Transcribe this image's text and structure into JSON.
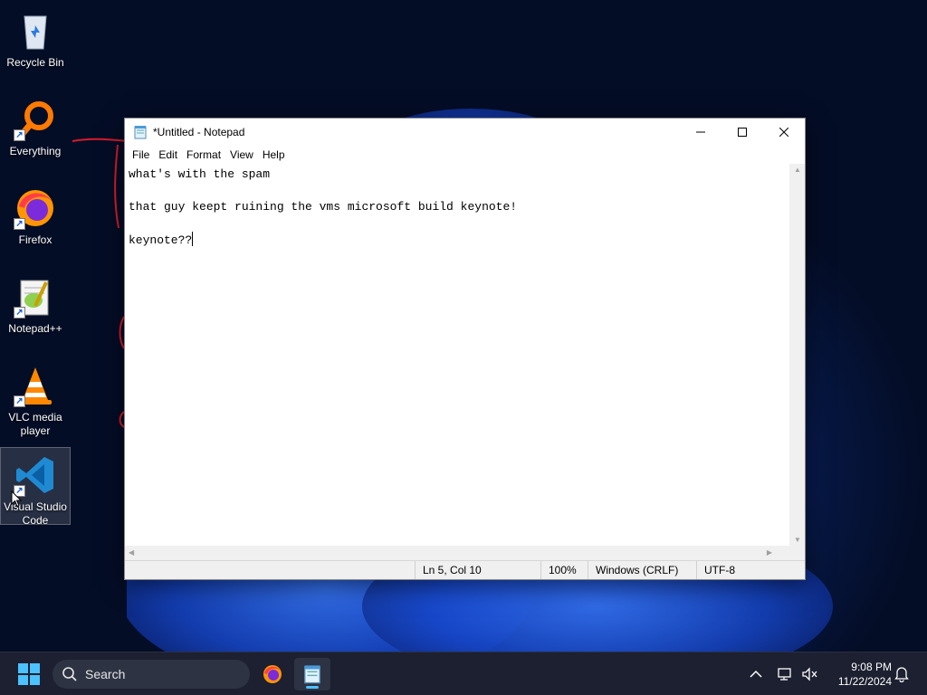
{
  "desktop": {
    "icons": [
      {
        "label": "Recycle Bin",
        "icon": "recycle-bin-icon"
      },
      {
        "label": "Everything",
        "icon": "everything-search-icon"
      },
      {
        "label": "Firefox",
        "icon": "firefox-icon"
      },
      {
        "label": "Notepad++",
        "icon": "notepadpp-icon"
      },
      {
        "label": "VLC media player",
        "icon": "vlc-icon"
      },
      {
        "label": "Visual Studio Code",
        "icon": "vscode-icon"
      }
    ]
  },
  "notepad": {
    "title": "*Untitled - Notepad",
    "menu": [
      "File",
      "Edit",
      "Format",
      "View",
      "Help"
    ],
    "lines": [
      "what's with the spam",
      "",
      "that guy keept ruining the vms microsoft build keynote!",
      "",
      "keynote??"
    ],
    "status": {
      "position": "Ln 5, Col 10",
      "zoom": "100%",
      "line_ending": "Windows (CRLF)",
      "encoding": "UTF-8"
    }
  },
  "taskbar": {
    "search_placeholder": "Search",
    "time": "9:08 PM",
    "date": "11/22/2024"
  },
  "colors": {
    "accent": "#4cc2ff",
    "scribble": "#d81b2a",
    "wallpaper_blue": "#1c4fd6"
  }
}
